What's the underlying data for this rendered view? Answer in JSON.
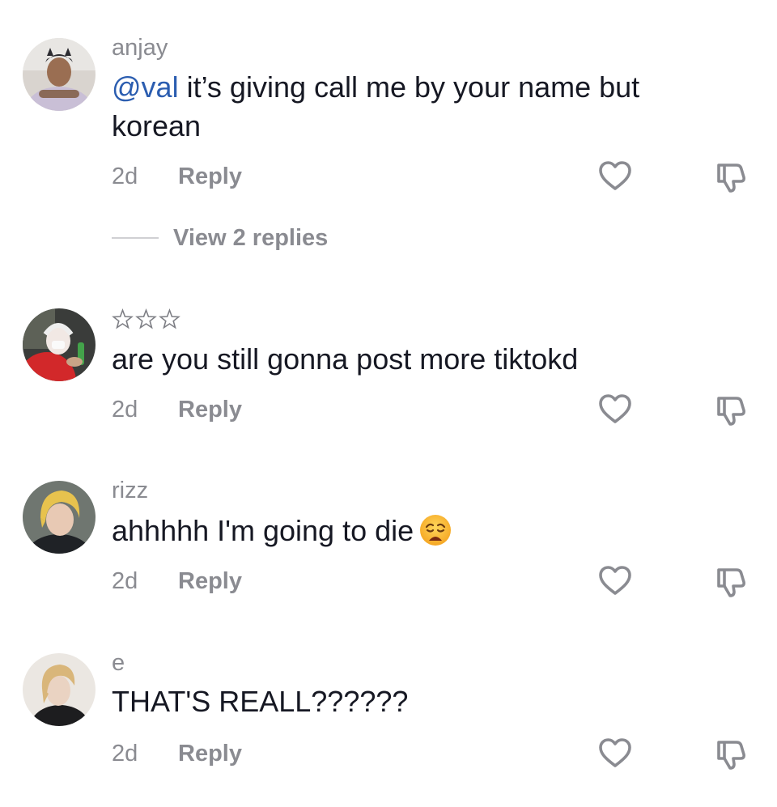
{
  "comments": [
    {
      "username": "anjay",
      "mention": "@val",
      "text": " it’s giving call me by your name but korean",
      "time": "2d",
      "reply_label": "Reply",
      "replies_label": "View 2 replies"
    },
    {
      "username_icon": "three-stars",
      "text": "are you still gonna post more tiktokd",
      "time": "2d",
      "reply_label": "Reply"
    },
    {
      "username": "rizz",
      "text": "ahhhhh I'm going to die",
      "emoji": "weary-face-emoji",
      "time": "2d",
      "reply_label": "Reply"
    },
    {
      "username": "e",
      "text": "THAT'S REALL??????",
      "time": "2d",
      "reply_label": "Reply"
    }
  ],
  "colors": {
    "mention": "#2b5db0",
    "secondary_text": "#8a8b91",
    "primary_text": "#161823"
  },
  "icons": {
    "like": "heart-outline-icon",
    "dislike": "thumbs-down-outline-icon"
  }
}
